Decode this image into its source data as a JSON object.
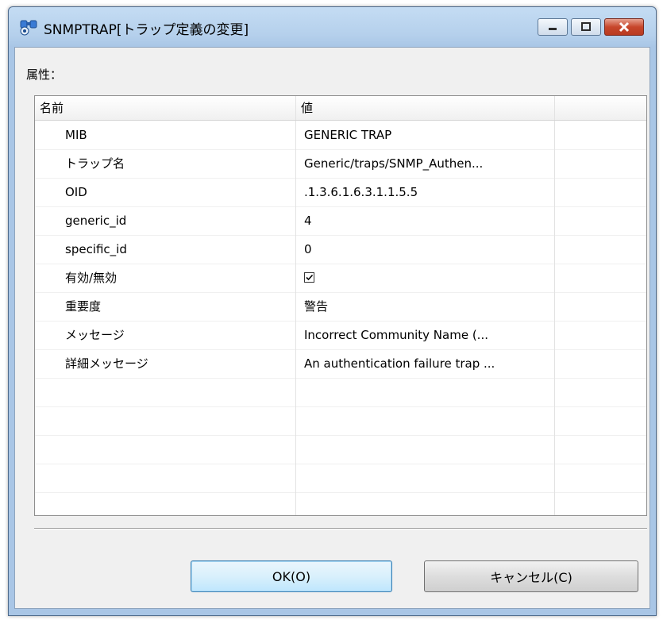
{
  "window": {
    "title": "SNMPTRAP[トラップ定義の変更]",
    "controls": {
      "minimize": "minimize-icon",
      "maximize": "maximize-icon",
      "close": "close-icon"
    }
  },
  "attributes_label": "属性：",
  "table": {
    "headers": [
      "名前",
      "値",
      ""
    ],
    "rows": [
      {
        "name": "MIB",
        "value": "GENERIC TRAP"
      },
      {
        "name": "トラップ名",
        "value": "Generic/traps/SNMP_Authen..."
      },
      {
        "name": "OID",
        "value": ".1.3.6.1.6.3.1.1.5.5"
      },
      {
        "name": "generic_id",
        "value": "4"
      },
      {
        "name": "specific_id",
        "value": "0"
      },
      {
        "name": "有効/無効",
        "value": "",
        "checkbox": true,
        "checked": true
      },
      {
        "name": "重要度",
        "value": "警告"
      },
      {
        "name": "メッセージ",
        "value": "Incorrect Community Name (..."
      },
      {
        "name": "詳細メッセージ",
        "value": "An authentication failure trap ..."
      }
    ]
  },
  "buttons": {
    "ok": "OK(O)",
    "cancel": "キャンセル(C)"
  },
  "colors": {
    "close_button": "#c7462b",
    "ok_border": "#3c7fb1",
    "titlebar": "#b5d0ec"
  }
}
